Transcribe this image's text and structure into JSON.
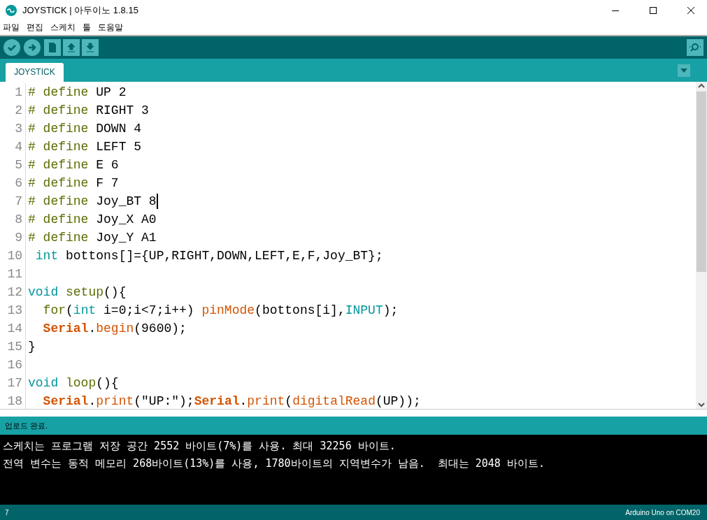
{
  "window": {
    "title": "JOYSTICK | 아두이노 1.8.15"
  },
  "menu": [
    "파일",
    "편집",
    "스케치",
    "툴",
    "도움말"
  ],
  "toolbar": [
    {
      "kind": "verify"
    },
    {
      "kind": "upload"
    },
    {
      "kind": "new"
    },
    {
      "kind": "open"
    },
    {
      "kind": "save"
    }
  ],
  "tabs": [
    {
      "label": "JOYSTICK",
      "selected": true
    }
  ],
  "editor": {
    "lines": [
      {
        "number": "1",
        "tokens": [
          {
            "kind": "preproc",
            "text": "# define"
          },
          {
            "kind": "plain",
            "text": " UP 2"
          }
        ]
      },
      {
        "number": "2",
        "tokens": [
          {
            "kind": "preproc",
            "text": "# define"
          },
          {
            "kind": "plain",
            "text": " RIGHT 3"
          }
        ]
      },
      {
        "number": "3",
        "tokens": [
          {
            "kind": "preproc",
            "text": "# define"
          },
          {
            "kind": "plain",
            "text": " DOWN 4"
          }
        ]
      },
      {
        "number": "4",
        "tokens": [
          {
            "kind": "preproc",
            "text": "# define"
          },
          {
            "kind": "plain",
            "text": " LEFT 5"
          }
        ]
      },
      {
        "number": "5",
        "tokens": [
          {
            "kind": "preproc",
            "text": "# define"
          },
          {
            "kind": "plain",
            "text": " E 6"
          }
        ]
      },
      {
        "number": "6",
        "tokens": [
          {
            "kind": "preproc",
            "text": "# define"
          },
          {
            "kind": "plain",
            "text": " F 7"
          }
        ]
      },
      {
        "number": "7",
        "cursor": true,
        "tokens": [
          {
            "kind": "preproc",
            "text": "# define"
          },
          {
            "kind": "plain",
            "text": " Joy_BT 8"
          }
        ]
      },
      {
        "number": "8",
        "tokens": [
          {
            "kind": "preproc",
            "text": "# define"
          },
          {
            "kind": "plain",
            "text": " Joy_X A0"
          }
        ]
      },
      {
        "number": "9",
        "tokens": [
          {
            "kind": "preproc",
            "text": "# define"
          },
          {
            "kind": "plain",
            "text": " Joy_Y A1"
          }
        ]
      },
      {
        "number": "10",
        "tokens": [
          {
            "kind": "type",
            "text": " int"
          },
          {
            "kind": "plain",
            "text": " bottons[]={UP,RIGHT,DOWN,LEFT,E,F,Joy_BT};"
          }
        ]
      },
      {
        "number": "11"
      },
      {
        "number": "12",
        "tokens": [
          {
            "kind": "type",
            "text": "void"
          },
          {
            "kind": "preproc",
            "text": " setup"
          },
          {
            "kind": "plain",
            "text": "(){"
          }
        ]
      },
      {
        "number": "13",
        "tokens": [
          {
            "kind": "preproc",
            "text": "  for"
          },
          {
            "kind": "plain",
            "text": "("
          },
          {
            "kind": "type",
            "text": "int"
          },
          {
            "kind": "plain",
            "text": " i=0;i<7;i++) "
          },
          {
            "kind": "func",
            "text": "pinMode"
          },
          {
            "kind": "plain",
            "text": "(bottons[i],"
          },
          {
            "kind": "type",
            "text": "INPUT"
          },
          {
            "kind": "plain",
            "text": ");"
          }
        ]
      },
      {
        "number": "14",
        "tokens": [
          {
            "kind": "object",
            "text": "  Serial"
          },
          {
            "kind": "plain",
            "text": "."
          },
          {
            "kind": "func",
            "text": "begin"
          },
          {
            "kind": "plain",
            "text": "(9600);"
          }
        ]
      },
      {
        "number": "15",
        "tokens": [
          {
            "kind": "plain",
            "text": "}"
          }
        ]
      },
      {
        "number": "16"
      },
      {
        "number": "17",
        "tokens": [
          {
            "kind": "type",
            "text": "void"
          },
          {
            "kind": "preproc",
            "text": " loop"
          },
          {
            "kind": "plain",
            "text": "(){"
          }
        ]
      },
      {
        "number": "18",
        "tokens": [
          {
            "kind": "object",
            "text": "  Serial"
          },
          {
            "kind": "plain",
            "text": "."
          },
          {
            "kind": "func",
            "text": "print"
          },
          {
            "kind": "plain",
            "text": "(\"UP:\");"
          },
          {
            "kind": "object",
            "text": "Serial"
          },
          {
            "kind": "plain",
            "text": "."
          },
          {
            "kind": "func",
            "text": "print"
          },
          {
            "kind": "plain",
            "text": "("
          },
          {
            "kind": "func",
            "text": "digitalRead"
          },
          {
            "kind": "plain",
            "text": "(UP));"
          }
        ]
      }
    ]
  },
  "message": "업로드 완료.",
  "console": [
    "스케치는 프로그램 저장 공간 2552 바이트(7%)를 사용. 최대 32256 바이트.",
    "전역 변수는 동적 메모리 268바이트(13%)를 사용, 1780바이트의 지역변수가 남음.  최대는 2048 바이트."
  ],
  "status_bar": {
    "line": "7",
    "board": "Arduino Uno on COM20"
  }
}
